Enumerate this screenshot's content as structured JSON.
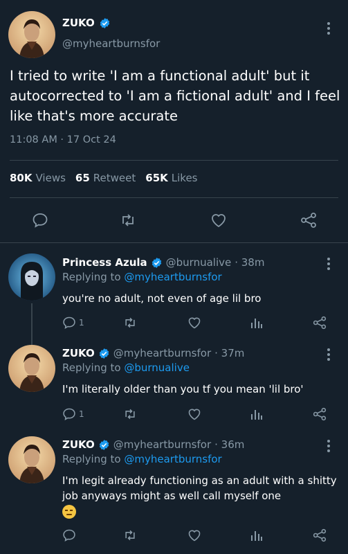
{
  "main_tweet": {
    "author_name": "ZUKO",
    "handle": "@myheartburnsfor",
    "text": "I tried to write 'I am a functional adult' but it autocorrected to 'I am a fictional adult' and I feel like that's more accurate",
    "timestamp": "11:08 AM · 17 Oct 24",
    "stats": [
      {
        "value": "80K",
        "label": "Views"
      },
      {
        "value": "65",
        "label": "Retweet"
      },
      {
        "value": "65K",
        "label": "Likes"
      }
    ],
    "actions": [
      "reply-icon",
      "retweet-icon",
      "like-icon",
      "share-icon"
    ]
  },
  "replies": [
    {
      "author_name": "Princess Azula",
      "handle": "@burnualive",
      "time": "· 38m",
      "replying_label": "Replying to",
      "replying_to": "@myheartburnsfor",
      "text": "you're no adult, not even of age lil bro",
      "reply_count": "1"
    },
    {
      "author_name": "ZUKO",
      "handle": "@myheartburnsfor",
      "time": "· 37m",
      "replying_label": "Replying to",
      "replying_to": "@burnualive",
      "text": "I'm literally older than you tf you mean 'lil bro'",
      "reply_count": "1"
    },
    {
      "author_name": "ZUKO",
      "handle": "@myheartburnsfor",
      "time": "· 36m",
      "replying_label": "Replying to",
      "replying_to": "@myheartburnsfor",
      "text": "I'm legit already functioning as an adult with a shitty job anyways might as well call myself one",
      "emoji": "unamused-face",
      "reply_count": ""
    }
  ],
  "colors": {
    "background": "#15202b",
    "muted": "#8899a6",
    "accent": "#1d9bf0",
    "divider": "#38444d"
  }
}
